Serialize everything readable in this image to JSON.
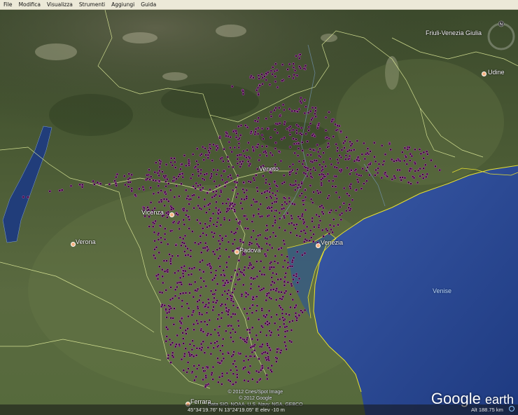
{
  "menu": {
    "items": [
      {
        "label": "File"
      },
      {
        "label": "Modifica"
      },
      {
        "label": "Visualizza"
      },
      {
        "label": "Strumenti"
      },
      {
        "label": "Aggiungi"
      },
      {
        "label": "Guida"
      }
    ]
  },
  "map": {
    "cities": {
      "udine": "Udine",
      "vicenza": "Vicenza",
      "verona": "Verona",
      "padova": "Padova",
      "venezia": "Venezia",
      "ferrara": "Ferrara"
    },
    "regions": {
      "friuli": "Friuli-Venezia Giulia",
      "veneto": "Veneto"
    },
    "sea": "Venise",
    "nav_letter": "N",
    "colors": {
      "marker": "#3a0a3a",
      "marker_stroke": "#c060c0",
      "border": "#e8f4a0",
      "coast": "#e8e030",
      "sea": "#2a4a8a"
    }
  },
  "attribution": {
    "line1": "© 2012 Cnes/Spot Image",
    "line2": "© 2012 Google",
    "line3": "Data SIO, NOAA, U.S. Navy, NGA, GEBCO"
  },
  "logo": {
    "google": "Google",
    "earth": "earth"
  },
  "status": {
    "coords": "45°34'19.76\" N  13°24'19.05\" E  elev   -10 m",
    "altitude": "Alt  188.75 km"
  }
}
